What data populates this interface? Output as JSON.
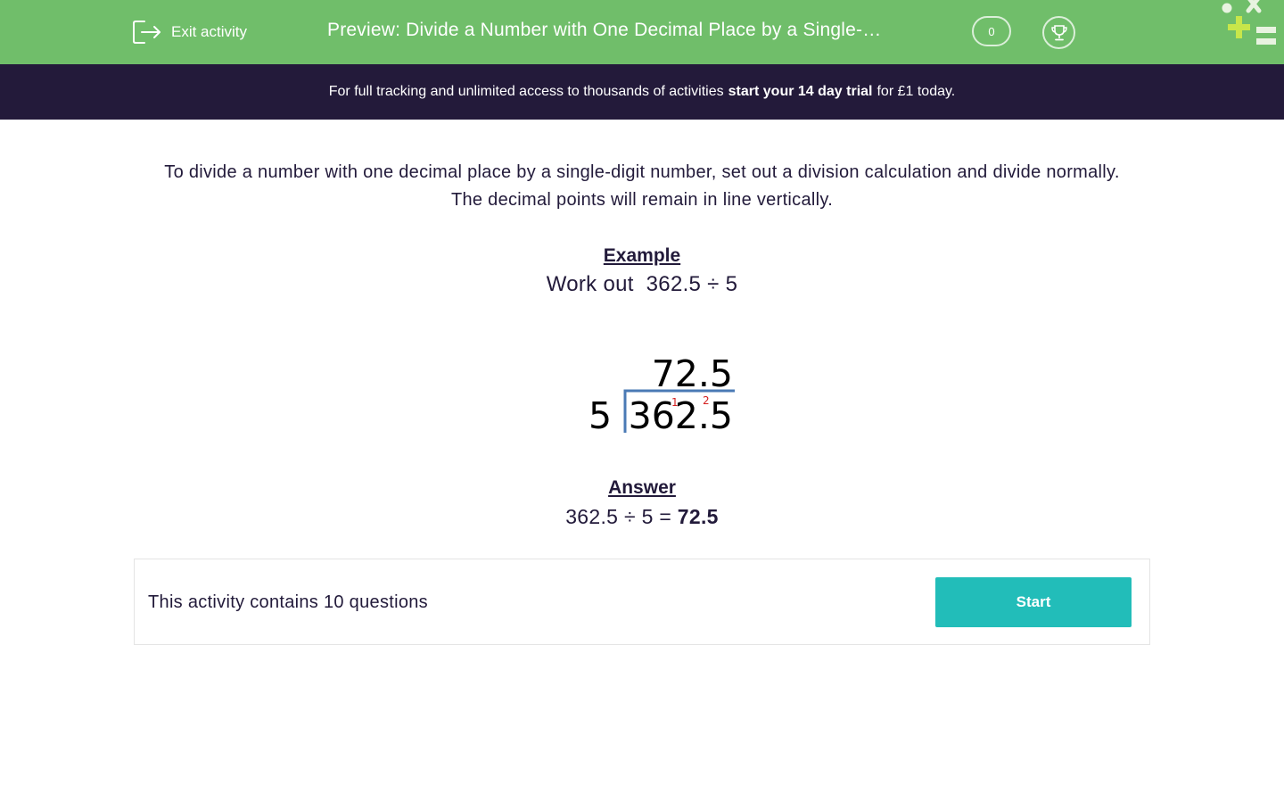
{
  "header": {
    "exit_label": "Exit activity",
    "title": "Preview: Divide a Number with One Decimal Place by a Single-…",
    "score": "0",
    "icons": {
      "exit": "exit-icon",
      "trophy": "trophy-icon",
      "logo": "edplace-logo"
    }
  },
  "banner": {
    "prefix": "For full tracking and unlimited access to thousands of activities",
    "link": "start your 14 day trial",
    "suffix": "for £1 today."
  },
  "intro": {
    "line1": "To divide a number with one decimal place by a single-digit number, set out a division calculation and divide normally.",
    "line2": "The decimal points will remain in line vertically."
  },
  "example": {
    "heading": "Example",
    "workout": "Work out  362.5 ÷ 5"
  },
  "division": {
    "quotient": "72.5",
    "divisor": "5",
    "dividend": "362.5",
    "carry_1": "1",
    "carry_2": "2"
  },
  "answer": {
    "heading": "Answer",
    "equation": "362.5 ÷ 5 =",
    "result": "72.5"
  },
  "footer": {
    "questions_text": "This activity contains 10 questions",
    "start_label": "Start"
  },
  "colors": {
    "header_bg": "#70be6a",
    "banner_bg": "#231a3a",
    "text": "#221a3a",
    "start_button": "#22bdb9",
    "division_line": "#4a7ab5",
    "carry": "#d42020",
    "logo_accent": "#c8e64a"
  }
}
